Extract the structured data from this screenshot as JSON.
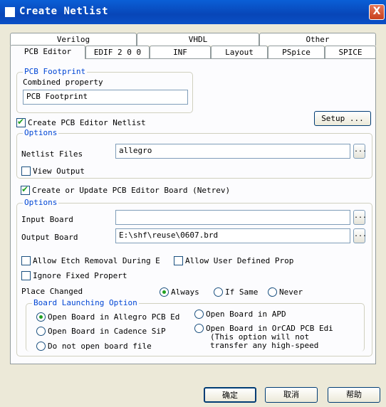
{
  "window": {
    "title": "Create Netlist",
    "close": "X"
  },
  "tabs_back": [
    "Verilog",
    "VHDL",
    "Other"
  ],
  "tabs_front": [
    "PCB Editor",
    "EDIF 2 0 0",
    "INF",
    "Layout",
    "PSpice",
    "SPICE"
  ],
  "pcb_footprint": {
    "group": "PCB Footprint",
    "label": "Combined property",
    "value": "PCB Footprint"
  },
  "create_netlist": {
    "label": "Create PCB Editor Netlist",
    "checked": true,
    "setup": "Setup ..."
  },
  "options1": {
    "group": "Options",
    "netlist_label": "Netlist Files",
    "netlist_value": "allegro",
    "browse": "...",
    "view_output": "View Output"
  },
  "netrev": {
    "label": "Create or Update PCB Editor Board (Netrev)",
    "checked": true
  },
  "options2": {
    "group": "Options",
    "input_label": "Input Board",
    "input_value": "",
    "output_label": "Output Board",
    "output_value": "E:\\shf\\reuse\\0607.brd",
    "browse": "..."
  },
  "checks": {
    "allow_etch": "Allow Etch Removal During E",
    "allow_user": "Allow User Defined Prop",
    "ignore_fixed": "Ignore Fixed Propert"
  },
  "place": {
    "label": "Place Changed",
    "always": "Always",
    "if_same": "If Same",
    "never": "Never"
  },
  "launch": {
    "group": "Board Launching Option",
    "open_allegro": "Open Board in Allegro PCB Ed",
    "open_cadence": "Open Board in Cadence SiP",
    "no_open": "Do not open board file",
    "open_apd": "Open Board in APD",
    "open_orcad": "Open Board in OrCAD PCB Edi",
    "orcad_note1": "(This option will not",
    "orcad_note2": "transfer any high-speed"
  },
  "buttons": {
    "ok": "确定",
    "cancel": "取消",
    "help": "帮助"
  }
}
